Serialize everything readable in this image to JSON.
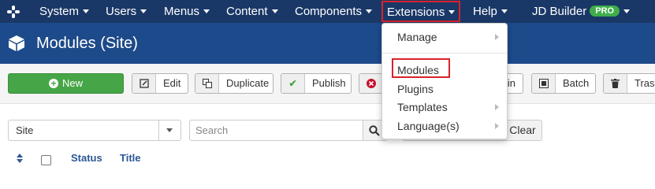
{
  "nav": {
    "items": [
      {
        "label": "System"
      },
      {
        "label": "Users"
      },
      {
        "label": "Menus"
      },
      {
        "label": "Content"
      },
      {
        "label": "Components"
      },
      {
        "label": "Extensions"
      },
      {
        "label": "Help"
      },
      {
        "label": "JD Builder"
      }
    ],
    "pro_badge": "PRO",
    "accent_color": "#d9222a"
  },
  "header": {
    "title": "Modules (Site)"
  },
  "toolbar": {
    "new_label": "New",
    "edit_label": "Edit",
    "duplicate_label": "Duplicate",
    "publish_label": "Publish",
    "checkin_label": "in",
    "batch_label": "Batch",
    "trash_label": "Trash"
  },
  "filters": {
    "site_select": "Site",
    "search_placeholder": "Search",
    "clear_label": "Clear"
  },
  "table": {
    "columns": [
      "Status",
      "Title"
    ]
  },
  "dropdown": {
    "items": [
      {
        "label": "Manage",
        "has_submenu": true
      },
      {
        "label": "Modules",
        "has_submenu": false,
        "highlighted": true
      },
      {
        "label": "Plugins",
        "has_submenu": false
      },
      {
        "label": "Templates",
        "has_submenu": true
      },
      {
        "label": "Language(s)",
        "has_submenu": true
      }
    ]
  },
  "colors": {
    "topnav_bg": "#1a3867",
    "titlebar_bg": "#1d4a8a",
    "new_button": "#46a546",
    "pro_badge": "#3eae4a"
  }
}
